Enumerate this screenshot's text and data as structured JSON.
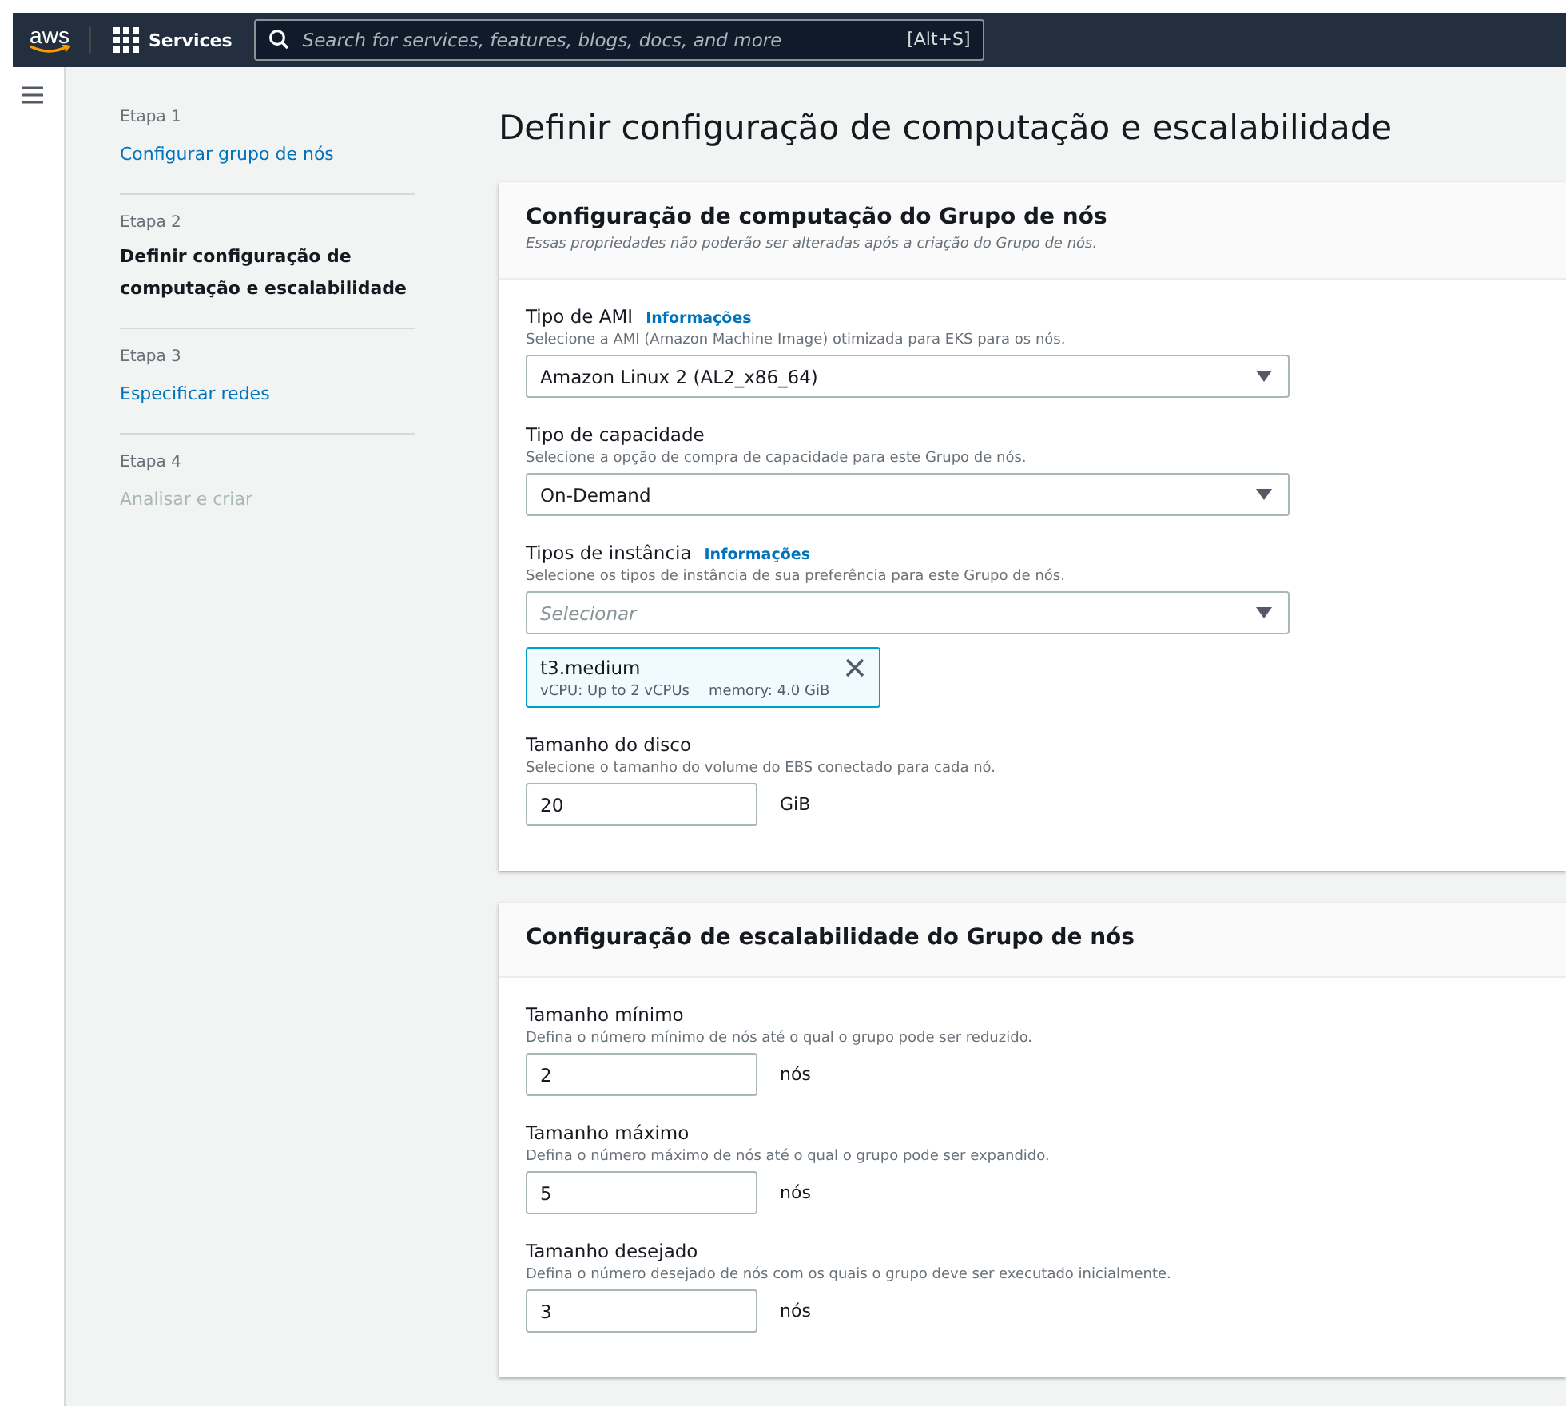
{
  "top_bar": {
    "logo": "aws",
    "services": "Services",
    "search": {
      "placeholder": "Search for services, features, blogs, docs, and more",
      "shortcut": "[Alt+S]"
    }
  },
  "steps": [
    {
      "step": "Etapa 1",
      "label": "Configurar grupo de nós",
      "selected": false,
      "disabled": false
    },
    {
      "step": "Etapa 2",
      "label": "Definir configuração de computação e escalabilidade",
      "selected": true,
      "disabled": false
    },
    {
      "step": "Etapa 3",
      "label": "Especificar redes",
      "selected": false,
      "disabled": false
    },
    {
      "step": "Etapa 4",
      "label": "Analisar e criar",
      "selected": false,
      "disabled": true
    }
  ],
  "page_title": "Definir configuração de computação e escalabilidade",
  "sections": [
    {
      "title": "Configuração de computação do Grupo de nós",
      "description": "Essas propriedades não poderão ser alteradas após a criação do Grupo de nós.",
      "fields": [
        {
          "kind": "select",
          "label": "Tipo de AMI",
          "info": "Informações",
          "hint": "Selecione a AMI (Amazon Machine Image) otimizada para EKS para os nós.",
          "value": "Amazon Linux 2 (AL2_x86_64)"
        },
        {
          "kind": "select",
          "label": "Tipo de capacidade",
          "hint": "Selecione a opção de compra de capacidade para este Grupo de nós.",
          "value": "On-Demand"
        },
        {
          "kind": "multiselect",
          "label": "Tipos de instância",
          "info": "Informações",
          "hint": "Selecione os tipos de instância de sua preferência para este Grupo de nós.",
          "placeholder": "Selecionar",
          "tokens": [
            {
              "name": "t3.medium",
              "vcpu": "vCPU: Up to 2 vCPUs",
              "memory": "memory: 4.0 GiB"
            }
          ]
        },
        {
          "kind": "number",
          "label": "Tamanho do disco",
          "hint": "Selecione o tamanho do volume do EBS conectado para cada nó.",
          "value": "20",
          "unit": "GiB"
        }
      ]
    },
    {
      "title": "Configuração de escalabilidade do Grupo de nós",
      "fields": [
        {
          "kind": "number",
          "label": "Tamanho mínimo",
          "hint": "Defina o número mínimo de nós até o qual o grupo pode ser reduzido.",
          "value": "2",
          "unit": "nós"
        },
        {
          "kind": "number",
          "label": "Tamanho máximo",
          "hint": "Defina o número máximo de nós até o qual o grupo pode ser expandido.",
          "value": "5",
          "unit": "nós"
        },
        {
          "kind": "number",
          "label": "Tamanho desejado",
          "hint": "Defina o número desejado de nós com os quais o grupo deve ser executado inicialmente.",
          "value": "3",
          "unit": "nós"
        }
      ]
    }
  ]
}
